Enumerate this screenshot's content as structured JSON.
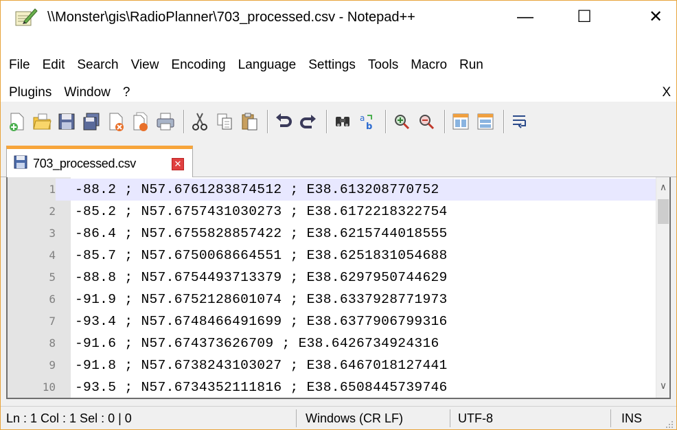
{
  "window": {
    "title": "\\\\Monster\\gis\\RadioPlanner\\703_processed.csv - Notepad++",
    "minimize_glyph": "—",
    "maximize_glyph": "☐",
    "close_glyph": "✕"
  },
  "menu": {
    "row1": [
      "File",
      "Edit",
      "Search",
      "View",
      "Encoding",
      "Language",
      "Settings",
      "Tools",
      "Macro",
      "Run"
    ],
    "row2": [
      "Plugins",
      "Window",
      "?"
    ],
    "close_doc": "X"
  },
  "toolbar": {
    "icons": [
      "new-file-icon",
      "open-file-icon",
      "save-icon",
      "save-all-icon",
      "close-icon",
      "close-all-icon",
      "print-icon",
      "cut-icon",
      "copy-icon",
      "paste-icon",
      "undo-icon",
      "redo-icon",
      "find-icon",
      "replace-icon",
      "zoom-in-icon",
      "zoom-out-icon",
      "sync-vertical-icon",
      "sync-horizontal-icon",
      "word-wrap-icon"
    ]
  },
  "tab": {
    "label": "703_processed.csv",
    "close_glyph": "✕",
    "accent_color": "#f7a53b"
  },
  "editor": {
    "current_line": 1,
    "lines": [
      {
        "num": "1",
        "text": "-88.2 ; N57.6761283874512 ; E38.613208770752"
      },
      {
        "num": "2",
        "text": "-85.2 ; N57.6757431030273 ; E38.6172218322754"
      },
      {
        "num": "3",
        "text": "-86.4 ; N57.6755828857422 ; E38.6215744018555"
      },
      {
        "num": "4",
        "text": "-85.7 ; N57.6750068664551 ; E38.6251831054688"
      },
      {
        "num": "5",
        "text": "-88.8 ; N57.6754493713379 ; E38.6297950744629"
      },
      {
        "num": "6",
        "text": "-91.9 ; N57.6752128601074 ; E38.6337928771973"
      },
      {
        "num": "7",
        "text": "-93.4 ; N57.6748466491699 ; E38.6377906799316"
      },
      {
        "num": "8",
        "text": "-91.6 ; N57.674373626709 ; E38.6426734924316"
      },
      {
        "num": "9",
        "text": "-91.8 ; N57.6738243103027 ; E38.6467018127441"
      },
      {
        "num": "10",
        "text": "-93.5 ; N57.6734352111816 ; E38.6508445739746"
      }
    ]
  },
  "status": {
    "position": "Ln : 1    Col : 1    Sel : 0 | 0",
    "eol": "Windows (CR LF)",
    "encoding": "UTF-8",
    "mode": "INS"
  }
}
